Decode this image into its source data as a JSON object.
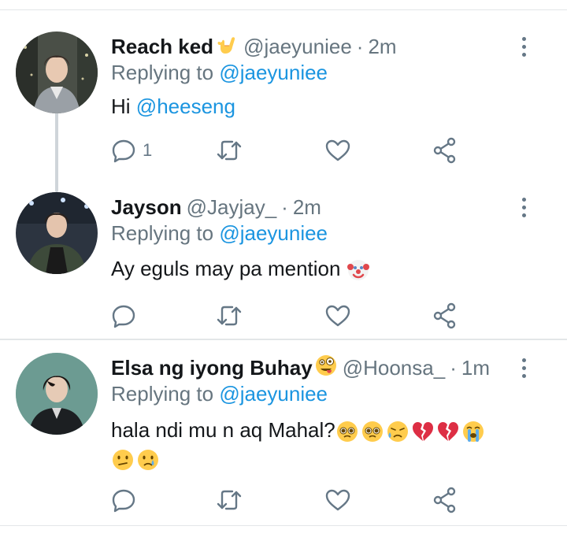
{
  "tweets": [
    {
      "name": "Reach ked",
      "name_emoji": "call-me-hand",
      "handle": "@jaeyuniee",
      "time": "2m",
      "reply_prefix": "Replying to",
      "reply_to": "@jaeyuniee",
      "text": "Hi",
      "text_mention": "@heeseng",
      "reply_count": "1",
      "avatar": "person-portrait"
    },
    {
      "name": "Jayson",
      "handle": "@Jayjay_",
      "time": "2m",
      "reply_prefix": "Replying to",
      "reply_to": "@jaeyuniee",
      "text": "Ay eguls may pa mention",
      "text_emojis": [
        "clown-face"
      ],
      "reply_count": "",
      "avatar": "person-portrait"
    },
    {
      "name": "Elsa ng iyong Buhay",
      "name_emoji": "zany-face",
      "handle": "@Hoonsa_",
      "time": "1m",
      "reply_prefix": "Replying to",
      "reply_to": "@jaeyuniee",
      "text": "hala ndi mu n aq Mahal?",
      "text_emojis": [
        "pleading-face",
        "pleading-face",
        "sad-sweat-face",
        "broken-heart",
        "broken-heart",
        "loudly-crying-face",
        "confused-face",
        "crying-face"
      ],
      "reply_count": "",
      "avatar": "person-portrait"
    }
  ],
  "icons": {
    "reply": "reply-icon",
    "retweet": "retweet-icon",
    "like": "heart-icon",
    "share": "share-icon",
    "more": "more-vertical-icon"
  },
  "colors": {
    "mention": "#1b95e0",
    "secondary_text": "#66757f",
    "icon": "#657786",
    "divider": "#e3e6e8",
    "thread_line": "#cfd5da"
  }
}
